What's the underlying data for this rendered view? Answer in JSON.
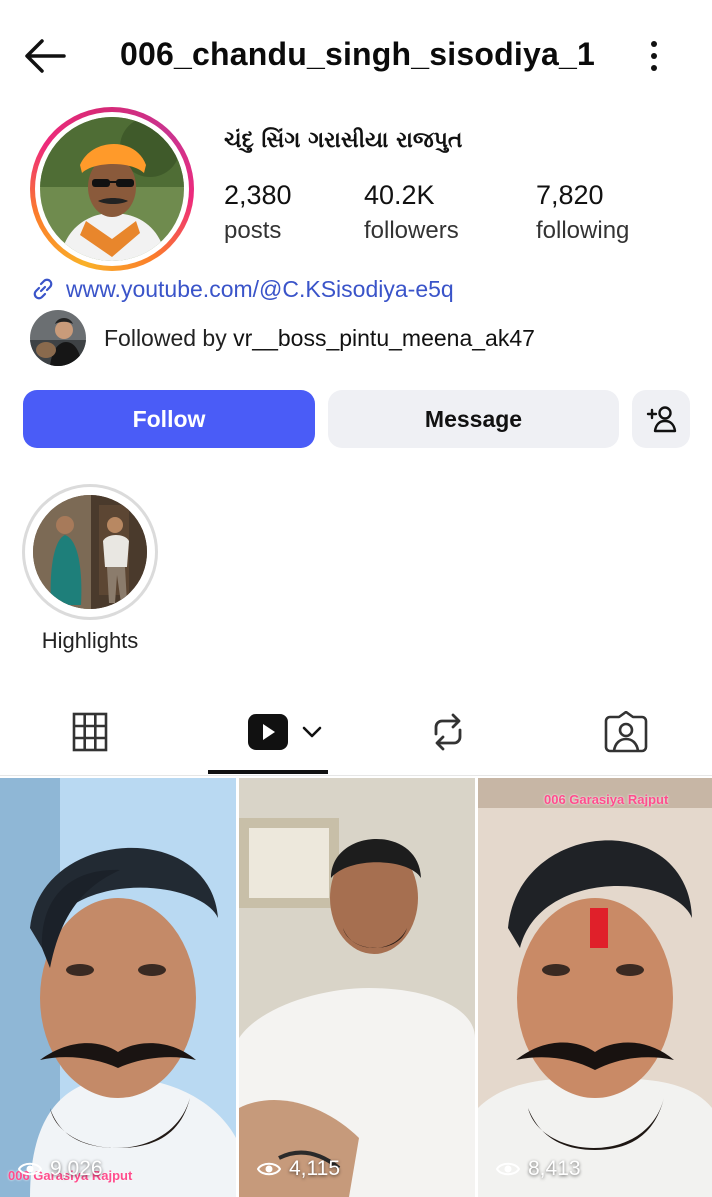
{
  "header": {
    "username": "006_chandu_singh_sisodiya_1"
  },
  "profile": {
    "full_name": "ચંદુ સિંગ ગરાસીયા રાજપુત",
    "stats": {
      "posts_count": "2,380",
      "posts_label": "posts",
      "followers_count": "40.2K",
      "followers_label": "followers",
      "following_count": "7,820",
      "following_label": "following"
    },
    "link": "www.youtube.com/@C.KSisodiya-e5q",
    "followed_by_prefix": "Followed by ",
    "followed_by_user": "vr__boss_pintu_meena_ak47"
  },
  "actions": {
    "follow_label": "Follow",
    "message_label": "Message"
  },
  "highlights": [
    {
      "label": "Highlights"
    }
  ],
  "tabs": [
    "grid-icon",
    "reels-icon",
    "reposts-icon",
    "tagged-icon"
  ],
  "reels": [
    {
      "views": "9,026",
      "caption": "006 Garasiya Rajput"
    },
    {
      "views": "4,115"
    },
    {
      "views": "8,413",
      "caption": "006 Garasiya Rajput"
    }
  ],
  "colors": {
    "follow_button": "#4a5cf7",
    "secondary_button": "#eff0f4",
    "link": "#3a54c9"
  }
}
